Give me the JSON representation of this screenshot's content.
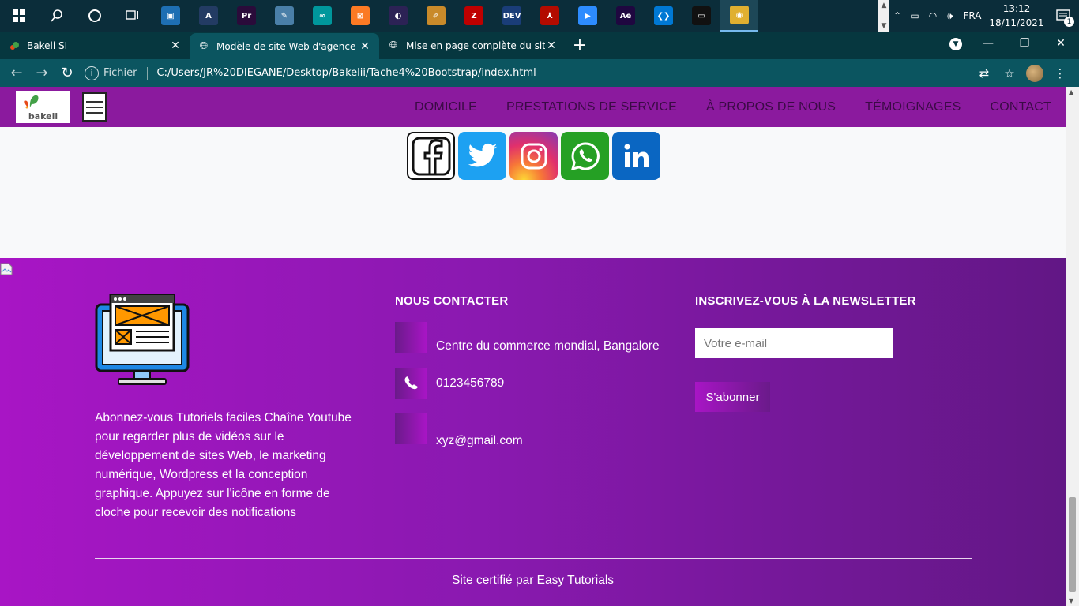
{
  "taskbar": {
    "apps": [
      {
        "name": "app-store-icon",
        "color": "#1e6fb3",
        "glyph": "▣",
        "active": false
      },
      {
        "name": "adobe-lightroom-icon",
        "color": "#233b63",
        "glyph": "A",
        "active": false
      },
      {
        "name": "adobe-premiere-icon",
        "color": "#2a0b3a",
        "glyph": "Pr",
        "active": false
      },
      {
        "name": "notepad-icon",
        "color": "#4a7fa8",
        "glyph": "✎",
        "active": false
      },
      {
        "name": "arduino-icon",
        "color": "#00979c",
        "glyph": "∞",
        "active": false
      },
      {
        "name": "xampp-icon",
        "color": "#fb7a24",
        "glyph": "⊠",
        "active": false
      },
      {
        "name": "eclipse-icon",
        "color": "#2c2255",
        "glyph": "◐",
        "active": false
      },
      {
        "name": "tool-icon",
        "color": "#c98a2a",
        "glyph": "✐",
        "active": false
      },
      {
        "name": "filezilla-icon",
        "color": "#bf0000",
        "glyph": "Z",
        "active": false
      },
      {
        "name": "dev-cpp-icon",
        "color": "#1a3d78",
        "glyph": "DEV",
        "active": false
      },
      {
        "name": "acrobat-icon",
        "color": "#b30b00",
        "glyph": "⅄",
        "active": false
      },
      {
        "name": "zoom-icon",
        "color": "#2d8cff",
        "glyph": "▶",
        "active": false
      },
      {
        "name": "after-effects-icon",
        "color": "#1f0740",
        "glyph": "Ae",
        "active": false
      },
      {
        "name": "vscode-icon",
        "color": "#0078d4",
        "glyph": "❮❯",
        "active": false
      },
      {
        "name": "terminal-icon",
        "color": "#111111",
        "glyph": "▭",
        "active": false
      },
      {
        "name": "chrome-icon",
        "color": "#e0b030",
        "glyph": "◉",
        "active": true
      }
    ],
    "lang": "FRA",
    "time": "13:12",
    "date": "18/11/2021",
    "notif_count": "1"
  },
  "tabs": [
    {
      "label": "Bakeli SI",
      "active": false
    },
    {
      "label": "Modèle de site Web d'agence - T",
      "active": true
    },
    {
      "label": "Mise en page complète du site W",
      "active": false
    }
  ],
  "address": {
    "info_label": "Fichier",
    "url": "C:/Users/JR%20DIEGANE/Desktop/Bakelii/Tache4%20Bootstrap/index.html"
  },
  "site": {
    "logo_text": "bakeli",
    "menu": [
      "DOMICILE",
      "PRESTATIONS DE SERVICE",
      "À PROPOS DE NOUS",
      "TÉMOIGNAGES",
      "CONTACT"
    ],
    "socials": [
      "facebook",
      "twitter",
      "instagram",
      "whatsapp",
      "linkedin"
    ],
    "footer": {
      "about": "Abonnez-vous Tutoriels faciles Chaîne Youtube pour regarder plus de vidéos sur le développement de sites Web, le marketing numérique, Wordpress et la conception graphique. Appuyez sur l'icône en forme de cloche pour recevoir des notifications",
      "contact_title": "NOUS CONTACTER",
      "address": "Centre du commerce mondial, Bangalore",
      "phone": "0123456789",
      "email": "xyz@gmail.com",
      "newsletter_title": "INSCRIVEZ-VOUS À LA NEWSLETTER",
      "email_placeholder": "Votre e-mail",
      "subscribe_label": "S'abonner",
      "copyright": "Site certifié par Easy Tutorials"
    }
  }
}
